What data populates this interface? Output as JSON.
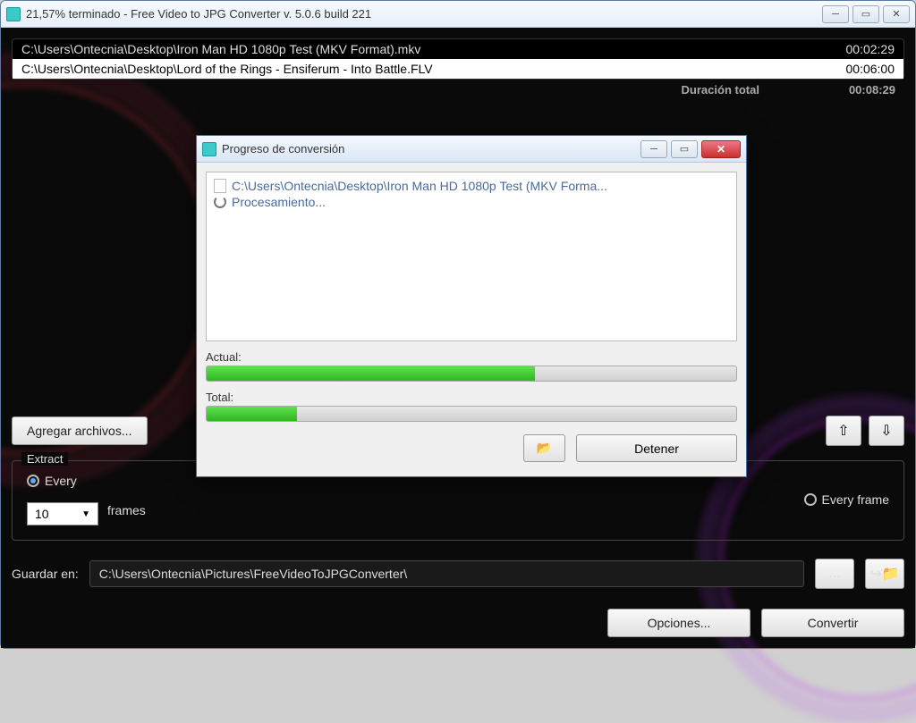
{
  "window": {
    "title": "21,57% terminado - Free Video to JPG Converter  v. 5.0.6 build 221"
  },
  "files": {
    "rows": [
      {
        "path": "C:\\Users\\Ontecnia\\Desktop\\Iron Man HD 1080p Test (MKV Format).mkv",
        "duration": "00:02:29",
        "selected": false
      },
      {
        "path": "C:\\Users\\Ontecnia\\Desktop\\Lord of the Rings - Ensiferum - Into Battle.FLV",
        "duration": "00:06:00",
        "selected": true
      }
    ],
    "total_label": "Duración total",
    "total_duration": "00:08:29"
  },
  "toolbar": {
    "add_files": "Agregar archivos..."
  },
  "extract": {
    "legend": "Extract",
    "every_label": "Every",
    "every_frame_label": "Every frame",
    "value": "10",
    "unit": "frames"
  },
  "save": {
    "label": "Guardar en:",
    "path": "C:\\Users\\Ontecnia\\Pictures\\FreeVideoToJPGConverter\\",
    "browse": "..."
  },
  "footer": {
    "options": "Opciones...",
    "convert": "Convertir"
  },
  "dialog": {
    "title": "Progreso de conversión",
    "file": "C:\\Users\\Ontecnia\\Desktop\\Iron Man HD 1080p Test (MKV Forma...",
    "processing": "Procesamiento...",
    "actual_label": "Actual:",
    "total_label": "Total:",
    "actual_pct": 62,
    "total_pct": 17,
    "stop": "Detener"
  }
}
